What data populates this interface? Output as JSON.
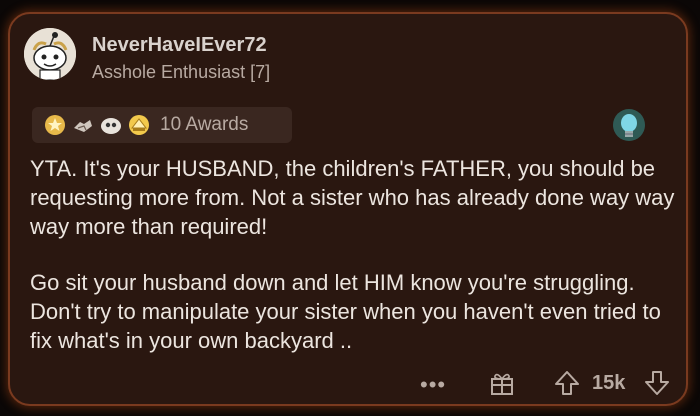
{
  "comment": {
    "author": "NeverHaveIEver72",
    "flair": "Asshole Enthusiast [7]",
    "awards_label": "10 Awards",
    "paragraphs": [
      "YTA. It's your HUSBAND, the children's FATHER, you should be requesting more from. Not a sister who has already done way way way more than required!",
      "Go sit your husband down and let HIM know you're struggling. Don't try to manipulate your sister when you haven't even tried to fix what's in your own backyard .."
    ],
    "more_options": "•••",
    "vote_count": "15k"
  },
  "icons": {
    "avatar": "snoo-avatar",
    "awards": [
      "gold-star-award-icon",
      "handshake-award-icon",
      "eye-face-award-icon",
      "hat-award-icon"
    ],
    "lightbulb": "lightbulb-icon",
    "gift": "gift-award-icon",
    "upvote": "upvote-icon",
    "downvote": "downvote-icon"
  },
  "colors": {
    "card_background": "#2a1710",
    "card_border_glow": "#7a3a1f",
    "text": "#ece5df",
    "muted": "#b8aaa2"
  }
}
